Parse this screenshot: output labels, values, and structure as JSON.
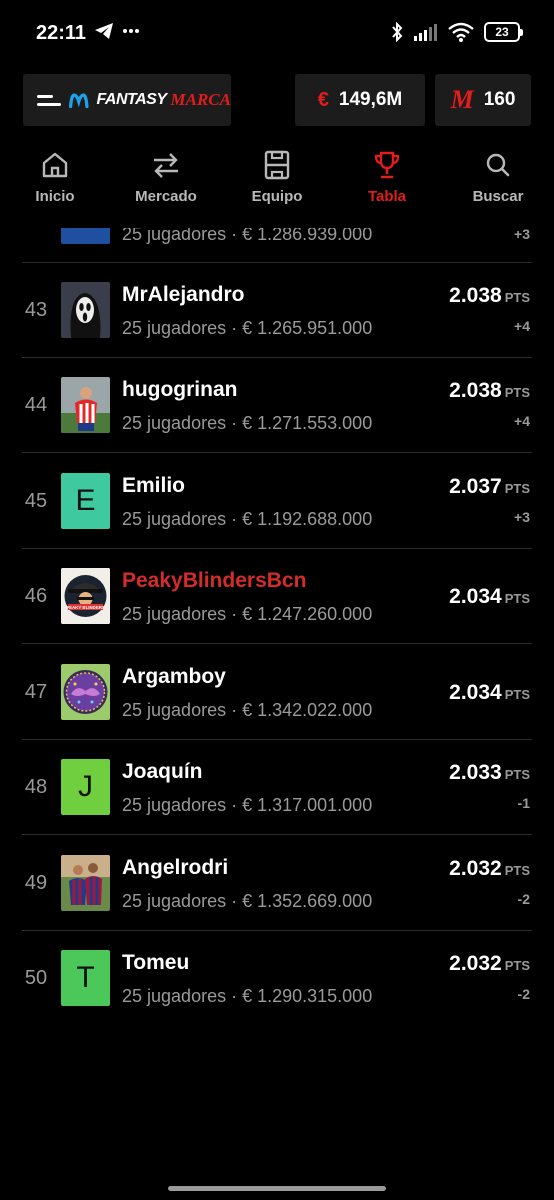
{
  "status_bar": {
    "time": "22:11",
    "battery": "23"
  },
  "header": {
    "brand": "FANTASY MARCA",
    "brand_fantasy": "FANTASY",
    "brand_marca": "MARCA",
    "money_symbol": "€",
    "money_value": "149,6M",
    "points_symbol": "M",
    "points_value": "160",
    "accent_color": "#e21d1d"
  },
  "tabs": [
    {
      "label": "Inicio",
      "icon": "home-icon",
      "active": false
    },
    {
      "label": "Mercado",
      "icon": "transfer-arrows-icon",
      "active": false
    },
    {
      "label": "Equipo",
      "icon": "field-icon",
      "active": false
    },
    {
      "label": "Tabla",
      "icon": "trophy-icon",
      "active": true
    },
    {
      "label": "Buscar",
      "icon": "search-icon",
      "active": false
    }
  ],
  "rows": [
    {
      "rank": "",
      "name": "",
      "meta": "25 jugadores · € 1.286.939.000",
      "points": "",
      "unit": "",
      "diff": "+3",
      "avatar_type": "image-stripes"
    },
    {
      "rank": "43",
      "name": "MrAlejandro",
      "meta": "25 jugadores · € 1.265.951.000",
      "points": "2.038",
      "unit": "PTS",
      "diff": "+4",
      "avatar_type": "image-ghostface"
    },
    {
      "rank": "44",
      "name": "hugogrinan",
      "meta": "25 jugadores · € 1.271.553.000",
      "points": "2.038",
      "unit": "PTS",
      "diff": "+4",
      "avatar_type": "image-player-red"
    },
    {
      "rank": "45",
      "name": "Emilio",
      "meta": "25 jugadores · € 1.192.688.000",
      "points": "2.037",
      "unit": "PTS",
      "diff": "+3",
      "avatar_type": "letter",
      "letter": "E",
      "avatar_color": "#3ec99f"
    },
    {
      "rank": "46",
      "name": "PeakyBlindersBcn",
      "meta": "25 jugadores · € 1.247.260.000",
      "points": "2.034",
      "unit": "PTS",
      "diff": "",
      "avatar_type": "image-peaky",
      "highlight": true,
      "logo_text": "PEAKY BLINDERS"
    },
    {
      "rank": "47",
      "name": "Argamboy",
      "meta": "25 jugadores · € 1.342.022.000",
      "points": "2.034",
      "unit": "PTS",
      "diff": "",
      "avatar_type": "image-mustache"
    },
    {
      "rank": "48",
      "name": "Joaquín",
      "meta": "25 jugadores · € 1.317.001.000",
      "points": "2.033",
      "unit": "PTS",
      "diff": "-1",
      "avatar_type": "letter",
      "letter": "J",
      "avatar_color": "#6fcf3f"
    },
    {
      "rank": "49",
      "name": "Angelrodri",
      "meta": "25 jugadores · € 1.352.669.000",
      "points": "2.032",
      "unit": "PTS",
      "diff": "-2",
      "avatar_type": "image-players-hug"
    },
    {
      "rank": "50",
      "name": "Tomeu",
      "meta": "25 jugadores · € 1.290.315.000",
      "points": "2.032",
      "unit": "PTS",
      "diff": "-2",
      "avatar_type": "letter",
      "letter": "T",
      "avatar_color": "#4cc75a"
    }
  ]
}
